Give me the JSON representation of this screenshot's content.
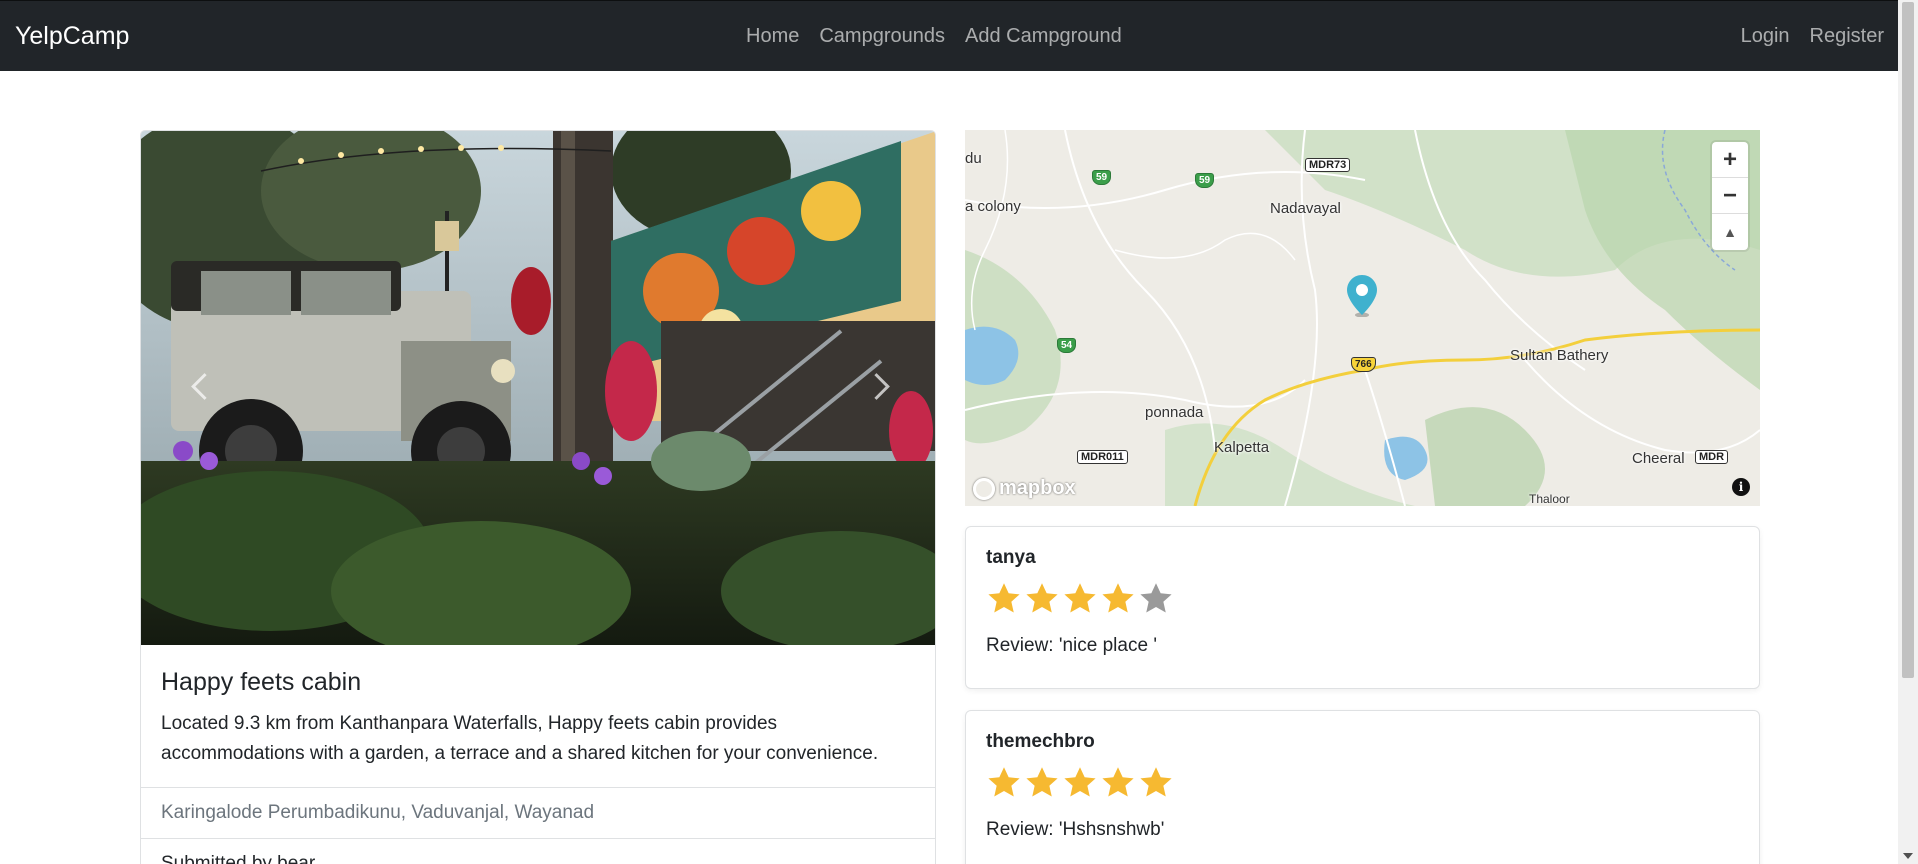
{
  "nav": {
    "brand": "YelpCamp",
    "links": [
      "Home",
      "Campgrounds",
      "Add Campground"
    ],
    "right_links": [
      "Login",
      "Register"
    ]
  },
  "campground": {
    "title": "Happy feets cabin",
    "description": "Located 9.3 km from Kanthanpara Waterfalls, Happy feets cabin provides accommodations with a garden, a terrace and a shared kitchen for your convenience.",
    "location": "Karingalode Perumbadikunu, Vaduvanjal, Wayanad",
    "submitted_by": "Submitted by bear"
  },
  "map": {
    "places": [
      "Nadavayal",
      "Sultan Bathery",
      "ponnada",
      "Kalpetta",
      "Cheeral",
      "Thaloor",
      "a colony",
      "du"
    ],
    "shields": [
      "MDR73",
      "59",
      "59",
      "54",
      "766",
      "MDR011",
      "MDR"
    ],
    "controls": {
      "zoom_in": "+",
      "zoom_out": "−",
      "compass": "▲"
    },
    "logo": "mapbox",
    "info": "i"
  },
  "reviews": [
    {
      "author": "tanya",
      "rating": 4,
      "max": 5,
      "text": "Review: 'nice place '"
    },
    {
      "author": "themechbro",
      "rating": 5,
      "max": 5,
      "text": "Review: 'Hshsnshwb'"
    }
  ],
  "colors": {
    "navbar": "#212529",
    "star_filled": "#f6b931",
    "star_empty": "#9a9a9a",
    "marker": "#3fb1ce"
  }
}
